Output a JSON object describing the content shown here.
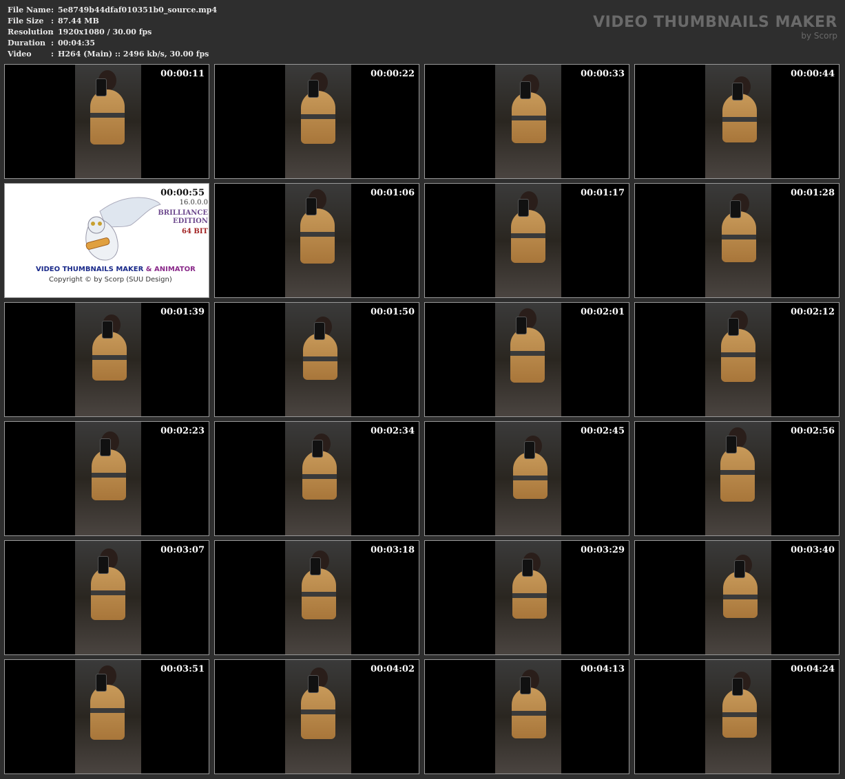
{
  "info": [
    {
      "key": "File Name",
      "sep": ":",
      "value": "5e8749b44dfaf010351b0_source.mp4"
    },
    {
      "key": "File Size",
      "sep": ":",
      "value": "87.44 MB"
    },
    {
      "key": "Resolution",
      "sep": ":",
      "value": "1920x1080 / 30.00 fps"
    },
    {
      "key": "Duration",
      "sep": ":",
      "value": "00:04:35"
    },
    {
      "key": "Video",
      "sep": ":",
      "value": "H264 (Main) :: 2496 kb/s, 30.00 fps"
    }
  ],
  "brand": {
    "title": "VIDEO THUMBNAILS MAKER",
    "subtitle": "by Scorp"
  },
  "splash": {
    "version": "16.0.0.0",
    "edition_line1": "BRILLIANCE",
    "edition_line2": "EDITION",
    "bits": "64 BIT",
    "title_part1": "VIDEO THUMBNAILS MAKER",
    "title_part2": " & ANIMATOR",
    "copyright": "Copyright © by Scorp (SUU Design)",
    "title_color1": "#1a2a8a",
    "title_color2": "#8a2a8a"
  },
  "thumbnails": [
    {
      "time": "00:00:11"
    },
    {
      "time": "00:00:22"
    },
    {
      "time": "00:00:33"
    },
    {
      "time": "00:00:44"
    },
    {
      "time": "00:00:55",
      "splash": true
    },
    {
      "time": "00:01:06"
    },
    {
      "time": "00:01:17"
    },
    {
      "time": "00:01:28"
    },
    {
      "time": "00:01:39"
    },
    {
      "time": "00:01:50"
    },
    {
      "time": "00:02:01"
    },
    {
      "time": "00:02:12"
    },
    {
      "time": "00:02:23"
    },
    {
      "time": "00:02:34"
    },
    {
      "time": "00:02:45"
    },
    {
      "time": "00:02:56"
    },
    {
      "time": "00:03:07"
    },
    {
      "time": "00:03:18"
    },
    {
      "time": "00:03:29"
    },
    {
      "time": "00:03:40"
    },
    {
      "time": "00:03:51"
    },
    {
      "time": "00:04:02"
    },
    {
      "time": "00:04:13"
    },
    {
      "time": "00:04:24"
    }
  ]
}
